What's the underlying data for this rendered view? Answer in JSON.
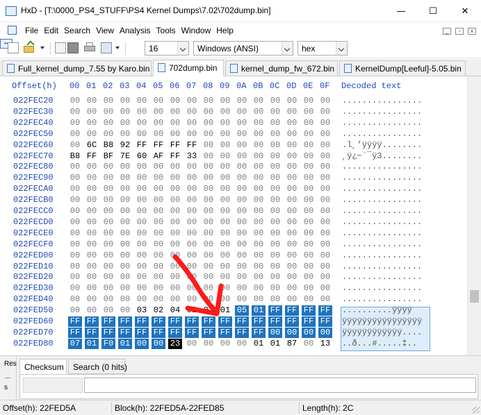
{
  "window": {
    "app_name": "HxD",
    "title": "HxD - [T:\\0000_PS4_STUFF\\PS4 Kernel Dumps\\7.02\\702dump.bin]",
    "min_glyph": "—",
    "max_glyph": "☐",
    "close_glyph": "✕"
  },
  "menu": {
    "items": [
      "File",
      "Edit",
      "Search",
      "View",
      "Analysis",
      "Tools",
      "Window",
      "Help"
    ],
    "mdi_controls": [
      "_",
      "▫",
      "x"
    ]
  },
  "toolbar": {
    "bytes_per_row": "16",
    "charset": "Windows (ANSI)",
    "offset_base": "hex",
    "icons": [
      "new-file-icon",
      "open-file-icon",
      "save-icon",
      "print-icon",
      "properties-icon",
      "bytes-per-row-icon"
    ]
  },
  "tabs": [
    {
      "label": "Full_kernel_dump_7.55 by Karo.bin",
      "active": false
    },
    {
      "label": "702dump.bin",
      "active": true
    },
    {
      "label": "kernel_dump_fw_672.bin",
      "active": false
    },
    {
      "label": "KernelDump[Leeful]-5.05.bin",
      "active": false
    }
  ],
  "hex": {
    "offset_header": "Offset(h)",
    "columns": [
      "00",
      "01",
      "02",
      "03",
      "04",
      "05",
      "06",
      "07",
      "08",
      "09",
      "0A",
      "0B",
      "0C",
      "0D",
      "0E",
      "0F"
    ],
    "decoded_header": "Decoded text",
    "rows": [
      {
        "offset": "022FEC20",
        "bytes": [
          "00",
          "00",
          "00",
          "00",
          "00",
          "00",
          "00",
          "00",
          "00",
          "00",
          "00",
          "00",
          "00",
          "00",
          "00",
          "00"
        ],
        "text": "................"
      },
      {
        "offset": "022FEC30",
        "bytes": [
          "00",
          "00",
          "00",
          "00",
          "00",
          "00",
          "00",
          "00",
          "00",
          "00",
          "00",
          "00",
          "00",
          "00",
          "00",
          "00"
        ],
        "text": "................"
      },
      {
        "offset": "022FEC40",
        "bytes": [
          "00",
          "00",
          "00",
          "00",
          "00",
          "00",
          "00",
          "00",
          "00",
          "00",
          "00",
          "00",
          "00",
          "00",
          "00",
          "00"
        ],
        "text": "................"
      },
      {
        "offset": "022FEC50",
        "bytes": [
          "00",
          "00",
          "00",
          "00",
          "00",
          "00",
          "00",
          "00",
          "00",
          "00",
          "00",
          "00",
          "00",
          "00",
          "00",
          "00"
        ],
        "text": "................"
      },
      {
        "offset": "022FEC60",
        "bytes": [
          "00",
          "6C",
          "B8",
          "92",
          "FF",
          "FF",
          "FF",
          "FF",
          "00",
          "00",
          "00",
          "00",
          "00",
          "00",
          "00",
          "00"
        ],
        "text": ".l¸’ÿÿÿÿ........"
      },
      {
        "offset": "022FEC70",
        "bytes": [
          "B8",
          "FF",
          "BF",
          "7E",
          "60",
          "AF",
          "FF",
          "33",
          "00",
          "00",
          "00",
          "00",
          "00",
          "00",
          "00",
          "00"
        ],
        "text": "¸ÿ¿~`¯ÿ3........"
      },
      {
        "offset": "022FEC80",
        "bytes": [
          "00",
          "00",
          "00",
          "00",
          "00",
          "00",
          "00",
          "00",
          "00",
          "00",
          "00",
          "00",
          "00",
          "00",
          "00",
          "00"
        ],
        "text": "................"
      },
      {
        "offset": "022FEC90",
        "bytes": [
          "00",
          "00",
          "00",
          "00",
          "00",
          "00",
          "00",
          "00",
          "00",
          "00",
          "00",
          "00",
          "00",
          "00",
          "00",
          "00"
        ],
        "text": "................"
      },
      {
        "offset": "022FECA0",
        "bytes": [
          "00",
          "00",
          "00",
          "00",
          "00",
          "00",
          "00",
          "00",
          "00",
          "00",
          "00",
          "00",
          "00",
          "00",
          "00",
          "00"
        ],
        "text": "................"
      },
      {
        "offset": "022FECB0",
        "bytes": [
          "00",
          "00",
          "00",
          "00",
          "00",
          "00",
          "00",
          "00",
          "00",
          "00",
          "00",
          "00",
          "00",
          "00",
          "00",
          "00"
        ],
        "text": "................"
      },
      {
        "offset": "022FECC0",
        "bytes": [
          "00",
          "00",
          "00",
          "00",
          "00",
          "00",
          "00",
          "00",
          "00",
          "00",
          "00",
          "00",
          "00",
          "00",
          "00",
          "00"
        ],
        "text": "................"
      },
      {
        "offset": "022FECD0",
        "bytes": [
          "00",
          "00",
          "00",
          "00",
          "00",
          "00",
          "00",
          "00",
          "00",
          "00",
          "00",
          "00",
          "00",
          "00",
          "00",
          "00"
        ],
        "text": "................"
      },
      {
        "offset": "022FECE0",
        "bytes": [
          "00",
          "00",
          "00",
          "00",
          "00",
          "00",
          "00",
          "00",
          "00",
          "00",
          "00",
          "00",
          "00",
          "00",
          "00",
          "00"
        ],
        "text": "................"
      },
      {
        "offset": "022FECF0",
        "bytes": [
          "00",
          "00",
          "00",
          "00",
          "00",
          "00",
          "00",
          "00",
          "00",
          "00",
          "00",
          "00",
          "00",
          "00",
          "00",
          "00"
        ],
        "text": "................"
      },
      {
        "offset": "022FED00",
        "bytes": [
          "00",
          "00",
          "00",
          "00",
          "00",
          "00",
          "00",
          "00",
          "00",
          "00",
          "00",
          "00",
          "00",
          "00",
          "00",
          "00"
        ],
        "text": "................"
      },
      {
        "offset": "022FED10",
        "bytes": [
          "00",
          "00",
          "00",
          "00",
          "00",
          "00",
          "00",
          "00",
          "00",
          "00",
          "00",
          "00",
          "00",
          "00",
          "00",
          "00"
        ],
        "text": "................"
      },
      {
        "offset": "022FED20",
        "bytes": [
          "00",
          "00",
          "00",
          "00",
          "00",
          "00",
          "00",
          "00",
          "00",
          "00",
          "00",
          "00",
          "00",
          "00",
          "00",
          "00"
        ],
        "text": "................"
      },
      {
        "offset": "022FED30",
        "bytes": [
          "00",
          "00",
          "00",
          "00",
          "00",
          "00",
          "00",
          "00",
          "00",
          "00",
          "00",
          "00",
          "00",
          "00",
          "00",
          "00"
        ],
        "text": "................"
      },
      {
        "offset": "022FED40",
        "bytes": [
          "00",
          "00",
          "00",
          "00",
          "00",
          "00",
          "00",
          "00",
          "00",
          "00",
          "00",
          "00",
          "00",
          "00",
          "00",
          "00"
        ],
        "text": "................"
      },
      {
        "offset": "022FED50",
        "bytes": [
          "00",
          "00",
          "00",
          "00",
          "03",
          "02",
          "04",
          "01",
          "01",
          "01",
          "05",
          "01",
          "FF",
          "FF",
          "FF",
          "FF"
        ],
        "text": "..........ÿÿÿÿ"
      },
      {
        "offset": "022FED60",
        "bytes": [
          "FF",
          "FF",
          "FF",
          "FF",
          "FF",
          "FF",
          "FF",
          "FF",
          "FF",
          "FF",
          "FF",
          "FF",
          "FF",
          "FF",
          "FF",
          "FF"
        ],
        "text": "ÿÿÿÿÿÿÿÿÿÿÿÿÿÿÿÿ"
      },
      {
        "offset": "022FED70",
        "bytes": [
          "FF",
          "FF",
          "FF",
          "FF",
          "FF",
          "FF",
          "FF",
          "FF",
          "FF",
          "FF",
          "FF",
          "FF",
          "00",
          "00",
          "00",
          "00"
        ],
        "text": "ÿÿÿÿÿÿÿÿÿÿÿÿ...."
      },
      {
        "offset": "022FED80",
        "bytes": [
          "07",
          "01",
          "F0",
          "01",
          "00",
          "00",
          "23",
          "00",
          "00",
          "00",
          "00",
          "01",
          "01",
          "87",
          "00",
          "13"
        ],
        "text": "..ð...#.....‡.."
      }
    ]
  },
  "bottom_panel": {
    "side_tab": [
      "Res",
      "...",
      "s"
    ],
    "tabs": [
      "Checksum",
      "Search (0 hits)"
    ]
  },
  "status": {
    "offset": "Offset(h): 22FED5A",
    "block": "Block(h): 22FED5A-22FED85",
    "length": "Length(h): 2C"
  },
  "colors": {
    "offset_blue": "#1f49b8",
    "selection": "#1e73be",
    "arrow_red": "#ff1a1a"
  }
}
